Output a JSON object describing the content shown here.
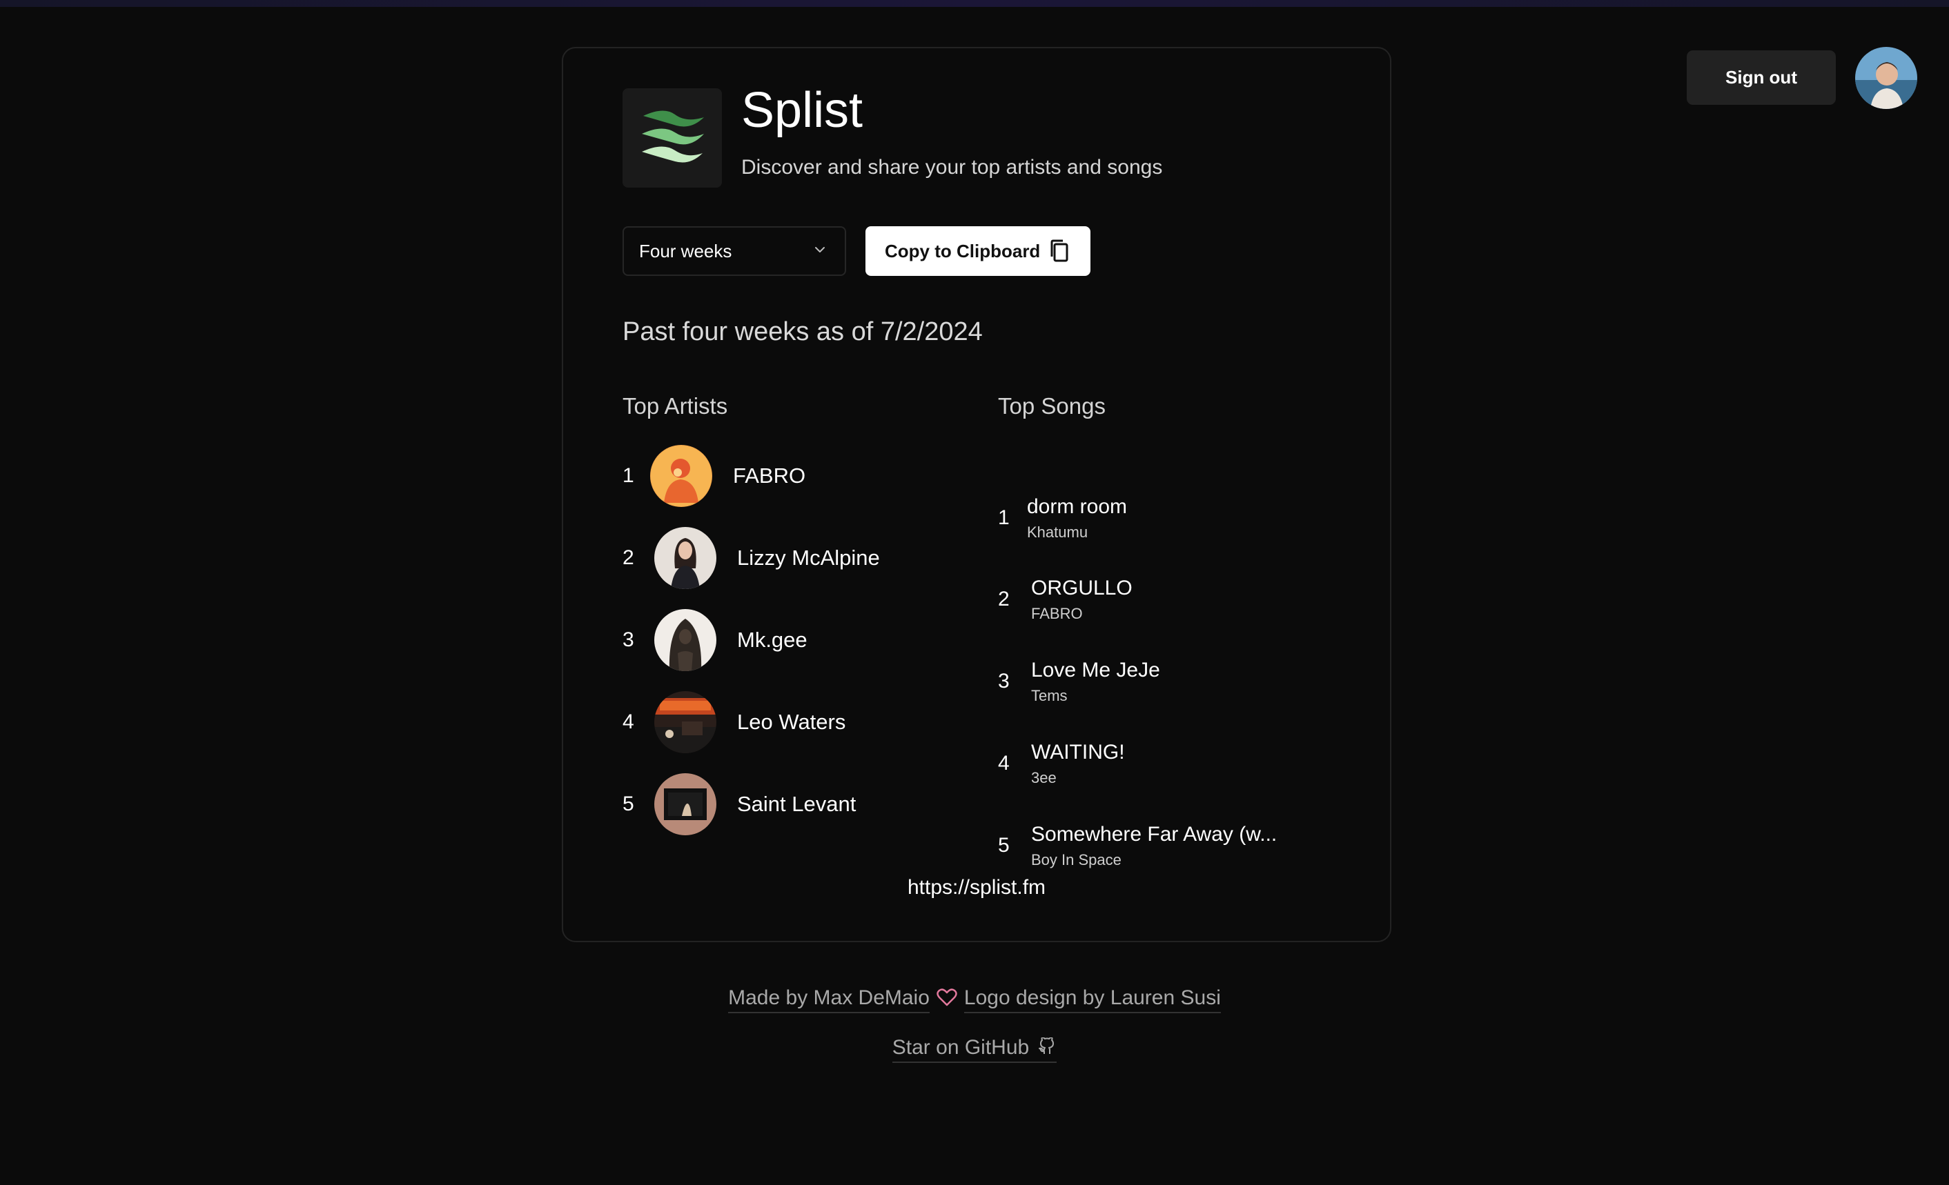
{
  "header": {
    "sign_out_label": "Sign out"
  },
  "app": {
    "title": "Splist",
    "subtitle": "Discover and share your top artists and songs"
  },
  "controls": {
    "period_selected": "Four weeks",
    "copy_label": "Copy to Clipboard"
  },
  "period_heading": "Past four weeks as of 7/2/2024",
  "top_artists": {
    "heading": "Top Artists",
    "items": [
      {
        "rank": "1",
        "name": "FABRO"
      },
      {
        "rank": "2",
        "name": "Lizzy McAlpine"
      },
      {
        "rank": "3",
        "name": "Mk.gee"
      },
      {
        "rank": "4",
        "name": "Leo Waters"
      },
      {
        "rank": "5",
        "name": "Saint Levant"
      }
    ]
  },
  "top_songs": {
    "heading": "Top Songs",
    "items": [
      {
        "rank": "1",
        "title": "dorm room",
        "artist": "Khatumu"
      },
      {
        "rank": "2",
        "title": "ORGULLO",
        "artist": "FABRO"
      },
      {
        "rank": "3",
        "title": "Love Me JeJe",
        "artist": "Tems"
      },
      {
        "rank": "4",
        "title": "WAITING!",
        "artist": "3ee"
      },
      {
        "rank": "5",
        "title": "Somewhere Far Away (w...",
        "artist": "Boy In Space"
      }
    ]
  },
  "site_url": "https://splist.fm",
  "footer": {
    "made_by": "Made by Max DeMaio",
    "logo_by": "Logo design by Lauren Susi",
    "github": "Star on GitHub"
  },
  "colors": {
    "background": "#0b0b0b",
    "card_border": "#232323",
    "logo_green_dark": "#3f8f4a",
    "logo_green_light": "#b9e3b4",
    "heart_pink": "#e3799d"
  },
  "icons": [
    "splist-logo-icon",
    "chevron-down-icon",
    "copy-icon",
    "heart-icon",
    "github-icon"
  ]
}
